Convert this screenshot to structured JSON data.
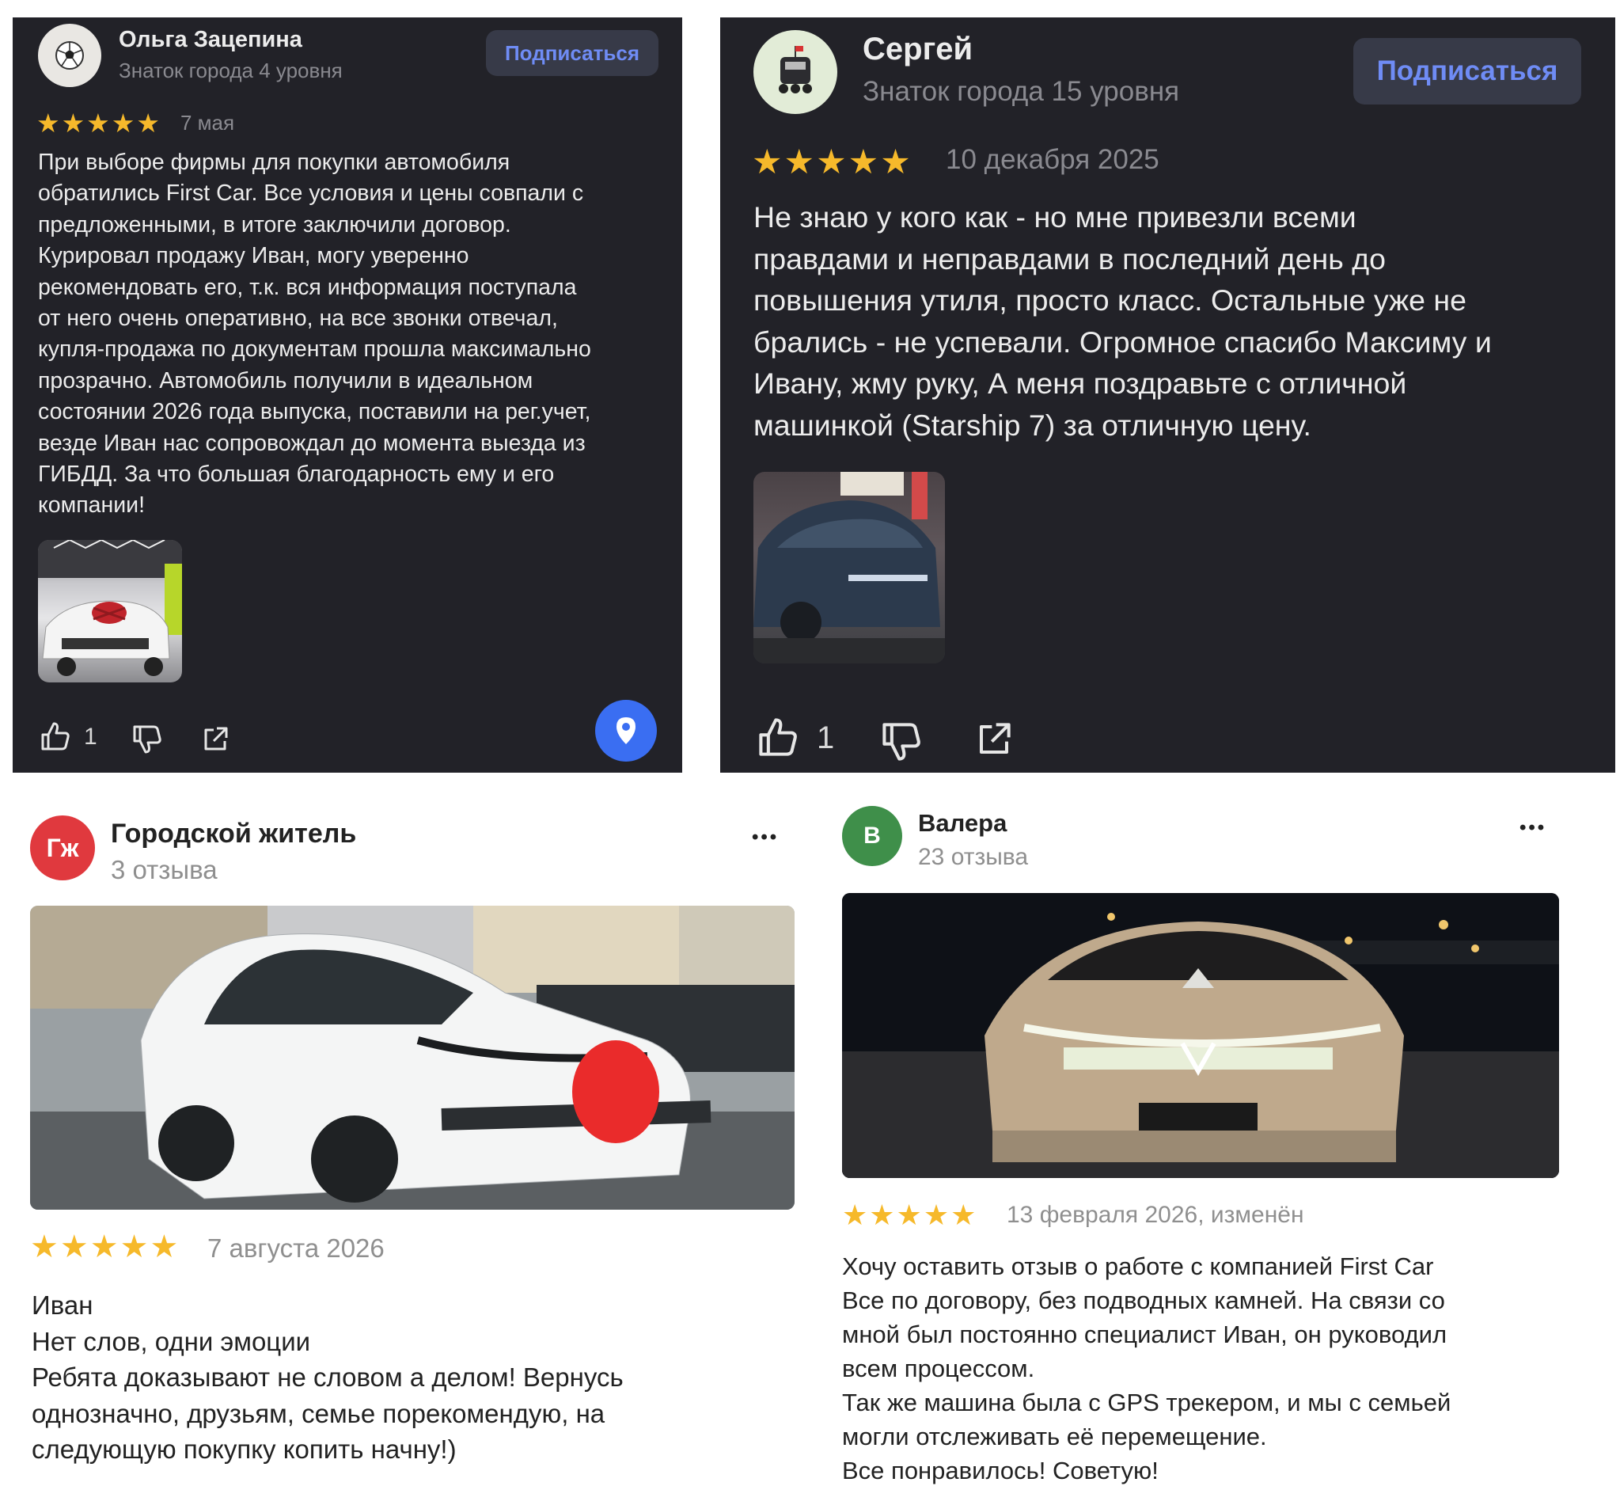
{
  "reviews": [
    {
      "author": "Ольга Зацепина",
      "subtitle": "Знаток города 4 уровня",
      "subscribe_label": "Подписаться",
      "stars": "★★★★★",
      "date": "7 мая",
      "text": "При выборе фирмы для покупки автомобиля\nобратились First Car. Все условия и цены совпали с\nпредложенными, в итоге заключили договор.\nКурировал продажу Иван, могу уверенно\nрекомендовать его, т.к. вся информация поступала\nот него очень оперативно, на все звонки отвечал,\nкупля-продажа по документам прошла максимально\nпрозрачно. Автомобиль получили в идеальном\nсостоянии 2026 года выпуска, поставили на рег.учет,\nвезде Иван нас сопровождал до момента выезда из\nГИБДД. За что большая благодарность ему и его\nкомпании!",
      "likes": "1",
      "avatar_icon": "soccer-ball-icon"
    },
    {
      "author": "Сергей",
      "subtitle": "Знаток города 15 уровня",
      "subscribe_label": "Подписаться",
      "stars": "★★★★★",
      "date": "10 декабря 2025",
      "text": "Не знаю у кого как - но мне привезли всеми\nправдами и неправдами в последний день до\nповышения утиля, просто класс. Остальные уже не\nбрались - не успевали. Огромное спасибо Максиму и\nИвану, жму руку, А меня поздравьте с отличной\nмашинкой (Starship 7) за отличную цену.",
      "likes": "1",
      "avatar_icon": "delivery-robot-icon"
    },
    {
      "author": "Городской житель",
      "subtitle": "3 отзыва",
      "avatar_initials": "Гж",
      "avatar_color": "#e0393e",
      "stars": "★★★★★",
      "date": "7 августа 2026",
      "text": "Иван\nНет слов, одни эмоции\nРебята доказывают не словом а делом! Вернусь\nоднозначно, друзьям, семье порекомендую, на\nследующую покупку копить начну!)",
      "more": "•••"
    },
    {
      "author": "Валера",
      "subtitle": "23 отзыва",
      "avatar_initials": "В",
      "avatar_color": "#3f8f4a",
      "stars": "★★★★★",
      "date": "13 февраля 2026, изменён",
      "text": "Хочу оставить отзыв о работе с компанией First Car\nВсе по договору, без подводных камней. На связи со\nмной был постоянно специалист Иван, он руководил\nвсем процессом.\nТак же машина была с GPS трекером, и мы с семьей\nмогли отслеживать её перемещение.\nВсе понравилось! Советую!",
      "more": "•••"
    }
  ],
  "colors": {
    "dark_card": "#222228",
    "star": "#f6b92b",
    "accent": "#6f8cf5",
    "map_button": "#3a6ef2"
  },
  "icons": [
    "thumbs-up-icon",
    "thumbs-down-icon",
    "share-icon",
    "map-pin-icon"
  ]
}
